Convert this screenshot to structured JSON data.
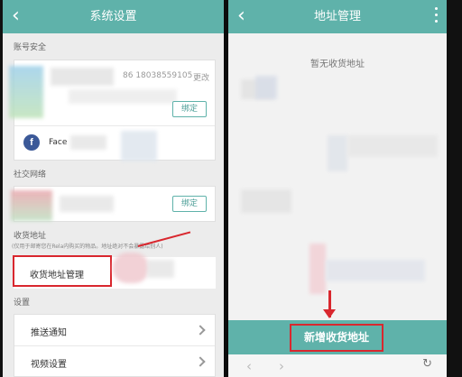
{
  "left_screen": {
    "title": "系统设置",
    "sections": {
      "account_security": "账号安全",
      "social_network": "社交网络",
      "shipping_address": "收货地址",
      "settings": "设置"
    },
    "account": {
      "phone_partial": "86 18038559105",
      "change_partial": "更改",
      "bind_label": "绑定",
      "facebook_partial": "Face"
    },
    "social": {
      "bind_label": "绑定"
    },
    "address": {
      "note": "(仅用于邮寄您在Rela内购买的物品。地址绝对不会暴露给别人)",
      "manage_label": "收货地址管理"
    },
    "settings_items": [
      {
        "label": "推送通知"
      },
      {
        "label": "视频设置"
      }
    ]
  },
  "right_screen": {
    "title": "地址管理",
    "empty_text": "暂无收货地址",
    "add_button": "新增收货地址"
  },
  "colors": {
    "teal": "#5fb2aa",
    "highlight_red": "#d9272e",
    "facebook_blue": "#3b5998"
  }
}
